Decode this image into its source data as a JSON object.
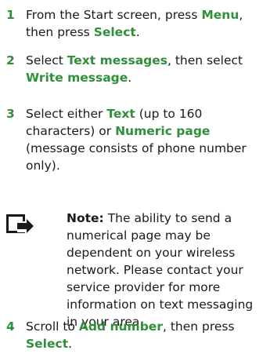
{
  "steps": [
    {
      "number": "1",
      "parts": [
        {
          "text": "From the Start screen, press "
        },
        {
          "kw": "Menu"
        },
        {
          "text": ", then press "
        },
        {
          "kw": "Select"
        },
        {
          "text": "."
        }
      ]
    },
    {
      "number": "2",
      "parts": [
        {
          "text": "Select "
        },
        {
          "kw": "Text messages"
        },
        {
          "text": ", then select "
        },
        {
          "kw": "Write message"
        },
        {
          "text": "."
        }
      ]
    },
    {
      "number": "3",
      "parts": [
        {
          "text": "Select either "
        },
        {
          "kw": "Text"
        },
        {
          "text": " (up to 160 characters) or "
        },
        {
          "kw": "Numeric page"
        },
        {
          "text": " (message consists of phone number only)."
        }
      ]
    },
    {
      "number": "4",
      "parts": [
        {
          "text": "Scroll to "
        },
        {
          "kw": "Add number"
        },
        {
          "text": ", then press "
        },
        {
          "kw": "Select"
        },
        {
          "text": "."
        }
      ]
    }
  ],
  "note": {
    "label": "Note:",
    "text": "The ability to send a numerical page may be dependent on your wireless network. Please contact your service provider for more information on text messaging in your area."
  },
  "icons": {
    "note": "note-icon"
  },
  "colors": {
    "accent": "#2f8f3a",
    "text": "#1a1a1a"
  }
}
